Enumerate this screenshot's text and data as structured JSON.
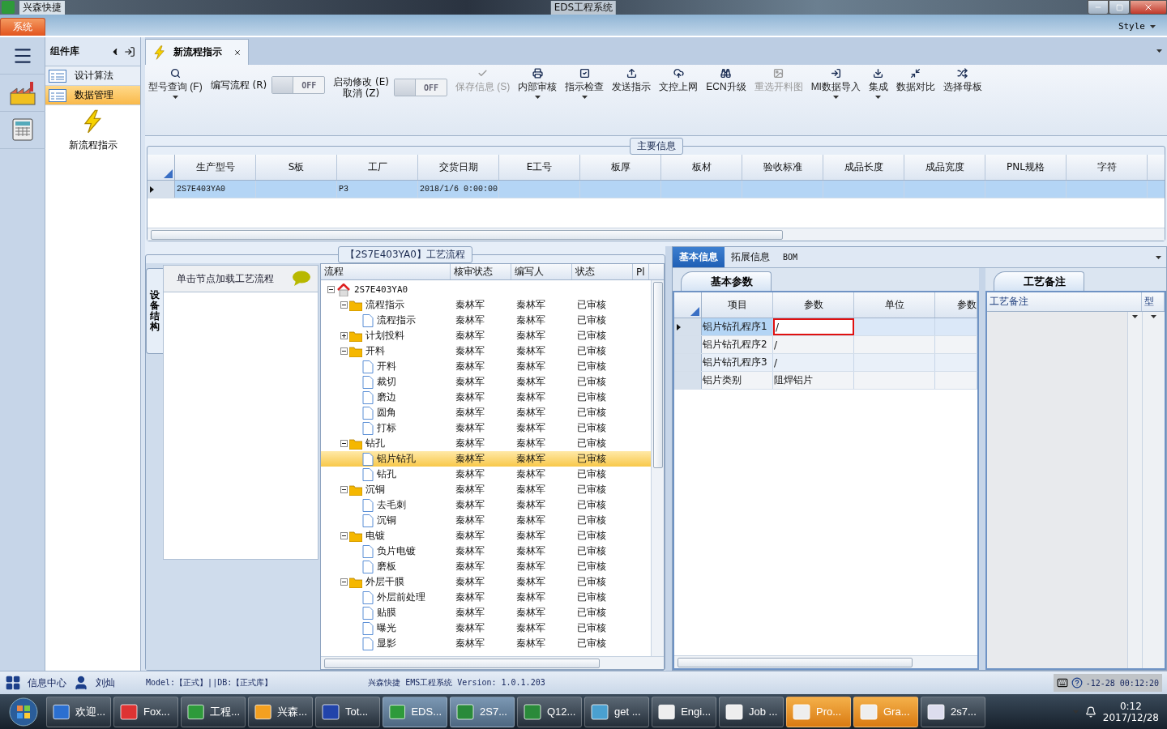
{
  "window": {
    "app_name": "兴森快捷",
    "title": "EDS工程系统"
  },
  "ribbon": {
    "tabs": [
      {
        "label": "系统",
        "selected": true
      }
    ],
    "style_label": "Style"
  },
  "nav_panel": {
    "title": "组件库",
    "items": [
      {
        "label": "设计算法",
        "selected": false
      },
      {
        "label": "数据管理",
        "selected": true
      }
    ],
    "tool": "新流程指示"
  },
  "document_tabs": [
    {
      "label": "新流程指示",
      "selected": true
    }
  ],
  "toolbar": [
    {
      "kind": "button",
      "label": "型号查询 (F)",
      "disabled": false,
      "menu": true
    },
    {
      "kind": "toggle",
      "label": "编写流程 (R)",
      "on": false,
      "switch_text": "OFF"
    },
    {
      "kind": "toggle",
      "label": "启动修改 (E)\n取消 (Z)",
      "on": false,
      "switch_text": "OFF"
    },
    {
      "kind": "button",
      "label": "保存信息 (S)",
      "disabled": true,
      "menu": false
    },
    {
      "kind": "button",
      "label": "内部审核",
      "disabled": false,
      "menu": true
    },
    {
      "kind": "button",
      "label": "指示检查",
      "disabled": false,
      "menu": true
    },
    {
      "kind": "button",
      "label": "发送指示",
      "disabled": false,
      "menu": false
    },
    {
      "kind": "button",
      "label": "文控上网",
      "disabled": false,
      "menu": false
    },
    {
      "kind": "button",
      "label": "ECN升级",
      "disabled": false,
      "menu": false
    },
    {
      "kind": "button",
      "label": "重选开料图",
      "disabled": true,
      "menu": false
    },
    {
      "kind": "button",
      "label": "MI数据导入",
      "disabled": false,
      "menu": true
    },
    {
      "kind": "button",
      "label": "集成",
      "disabled": false,
      "menu": true
    },
    {
      "kind": "button",
      "label": "数据对比",
      "disabled": false,
      "menu": false
    },
    {
      "kind": "button",
      "label": "选择母板",
      "disabled": false,
      "menu": false
    }
  ],
  "main_info": {
    "title": "主要信息",
    "columns": [
      "生产型号",
      "S板",
      "工厂",
      "交货日期",
      "E工号",
      "板厚",
      "板材",
      "验收标准",
      "成品长度",
      "成品宽度",
      "PNL规格",
      "字符"
    ],
    "rows": [
      {
        "selected": true,
        "cells": [
          "2S7E403YA0",
          null,
          "P3",
          "2018/1/6 0:00:00"
        ]
      }
    ]
  },
  "process": {
    "title": "【2S7E403YA0】工艺流程",
    "side_tab": "设备结构",
    "hint": "单击节点加载工艺流程",
    "columns": [
      "流程",
      "核审状态",
      "编写人",
      "状态",
      "Pl"
    ],
    "root": {
      "label": "2S7E403YA0",
      "kind": "root",
      "expanded": true,
      "selected": false,
      "children": [
        {
          "label": "流程指示",
          "kind": "folder",
          "expanded": true,
          "selected": false,
          "review": "秦林军",
          "writer": "秦林军",
          "status": "已审核",
          "children": [
            {
              "label": "流程指示",
              "kind": "doc",
              "selected": false,
              "review": "秦林军",
              "writer": "秦林军",
              "status": "已审核"
            }
          ]
        },
        {
          "label": "计划投料",
          "kind": "folder",
          "expanded": false,
          "selected": false,
          "review": "秦林军",
          "writer": "秦林军",
          "status": "已审核"
        },
        {
          "label": "开料",
          "kind": "folder",
          "expanded": true,
          "selected": false,
          "review": "秦林军",
          "writer": "秦林军",
          "status": "已审核",
          "children": [
            {
              "label": "开料",
              "kind": "doc",
              "selected": false,
              "review": "秦林军",
              "writer": "秦林军",
              "status": "已审核"
            },
            {
              "label": "裁切",
              "kind": "doc",
              "selected": false,
              "review": "秦林军",
              "writer": "秦林军",
              "status": "已审核"
            },
            {
              "label": "磨边",
              "kind": "doc",
              "selected": false,
              "review": "秦林军",
              "writer": "秦林军",
              "status": "已审核"
            },
            {
              "label": "圆角",
              "kind": "doc",
              "selected": false,
              "review": "秦林军",
              "writer": "秦林军",
              "status": "已审核"
            },
            {
              "label": "打标",
              "kind": "doc",
              "selected": false,
              "review": "秦林军",
              "writer": "秦林军",
              "status": "已审核"
            }
          ]
        },
        {
          "label": "钻孔",
          "kind": "folder",
          "expanded": true,
          "selected": false,
          "review": "秦林军",
          "writer": "秦林军",
          "status": "已审核",
          "children": [
            {
              "label": "铝片钻孔",
              "kind": "doc",
              "selected": true,
              "review": "秦林军",
              "writer": "秦林军",
              "status": "已审核"
            },
            {
              "label": "钻孔",
              "kind": "doc",
              "selected": false,
              "review": "秦林军",
              "writer": "秦林军",
              "status": "已审核"
            }
          ]
        },
        {
          "label": "沉铜",
          "kind": "folder",
          "expanded": true,
          "selected": false,
          "review": "秦林军",
          "writer": "秦林军",
          "status": "已审核",
          "children": [
            {
              "label": "去毛刺",
              "kind": "doc",
              "selected": false,
              "review": "秦林军",
              "writer": "秦林军",
              "status": "已审核"
            },
            {
              "label": "沉铜",
              "kind": "doc",
              "selected": false,
              "review": "秦林军",
              "writer": "秦林军",
              "status": "已审核"
            }
          ]
        },
        {
          "label": "电镀",
          "kind": "folder",
          "expanded": true,
          "selected": false,
          "review": "秦林军",
          "writer": "秦林军",
          "status": "已审核",
          "children": [
            {
              "label": "负片电镀",
              "kind": "doc",
              "selected": false,
              "review": "秦林军",
              "writer": "秦林军",
              "status": "已审核"
            },
            {
              "label": "磨板",
              "kind": "doc",
              "selected": false,
              "review": "秦林军",
              "writer": "秦林军",
              "status": "已审核"
            }
          ]
        },
        {
          "label": "外层干膜",
          "kind": "folder",
          "expanded": true,
          "selected": false,
          "review": "秦林军",
          "writer": "秦林军",
          "status": "已审核",
          "children": [
            {
              "label": "外层前处理",
              "kind": "doc",
              "selected": false,
              "review": "秦林军",
              "writer": "秦林军",
              "status": "已审核"
            },
            {
              "label": "贴膜",
              "kind": "doc",
              "selected": false,
              "review": "秦林军",
              "writer": "秦林军",
              "status": "已审核"
            },
            {
              "label": "曝光",
              "kind": "doc",
              "selected": false,
              "review": "秦林军",
              "writer": "秦林军",
              "status": "已审核"
            },
            {
              "label": "显影",
              "kind": "doc",
              "selected": false,
              "review": "秦林军",
              "writer": "秦林军",
              "status": "已审核"
            }
          ]
        }
      ]
    }
  },
  "detail_tabs": [
    {
      "label": "基本信息",
      "selected": true
    },
    {
      "label": "拓展信息",
      "selected": false
    },
    {
      "label": "BOM",
      "selected": false
    }
  ],
  "params": {
    "tab": "基本参数",
    "columns": [
      "项目",
      "参数",
      "单位",
      "参数"
    ],
    "rows": [
      {
        "item": "铝片钻孔程序1",
        "value": "/",
        "selected": true
      },
      {
        "item": "铝片钻孔程序2",
        "value": "/",
        "selected": false
      },
      {
        "item": "铝片钻孔程序3",
        "value": "/",
        "selected": false
      },
      {
        "item": "铝片类别",
        "value": "阻焊铝片",
        "selected": false
      }
    ]
  },
  "notes": {
    "tab": "工艺备注",
    "columns": [
      "工艺备注",
      "型"
    ]
  },
  "status_bar": {
    "info_center": "信息中心",
    "user": "刘灿",
    "model": "Model:【正式】||DB:【正式库】",
    "version": "兴森快捷 EMS工程系统 Version: 1.0.1.203",
    "time": "-12-28 00:12:20"
  },
  "taskbar": {
    "items": [
      {
        "label": "欢迎...",
        "active": false,
        "flashing": false
      },
      {
        "label": "Fox...",
        "active": false,
        "flashing": false
      },
      {
        "label": "工程...",
        "active": false,
        "flashing": false
      },
      {
        "label": "兴森...",
        "active": false,
        "flashing": false
      },
      {
        "label": "Tot...",
        "active": false,
        "flashing": false
      },
      {
        "label": "EDS...",
        "active": true,
        "flashing": false
      },
      {
        "label": "2S7...",
        "active": true,
        "flashing": false
      },
      {
        "label": "Q12...",
        "active": false,
        "flashing": false
      },
      {
        "label": "get ...",
        "active": false,
        "flashing": false
      },
      {
        "label": "Engi...",
        "active": false,
        "flashing": false
      },
      {
        "label": "Job ...",
        "active": false,
        "flashing": false
      },
      {
        "label": "Pro...",
        "active": false,
        "flashing": true
      },
      {
        "label": "Gra...",
        "active": false,
        "flashing": true
      },
      {
        "label": "2s7...",
        "active": false,
        "flashing": false
      }
    ],
    "clock_time": "0:12",
    "clock_date": "2017/12/28"
  }
}
